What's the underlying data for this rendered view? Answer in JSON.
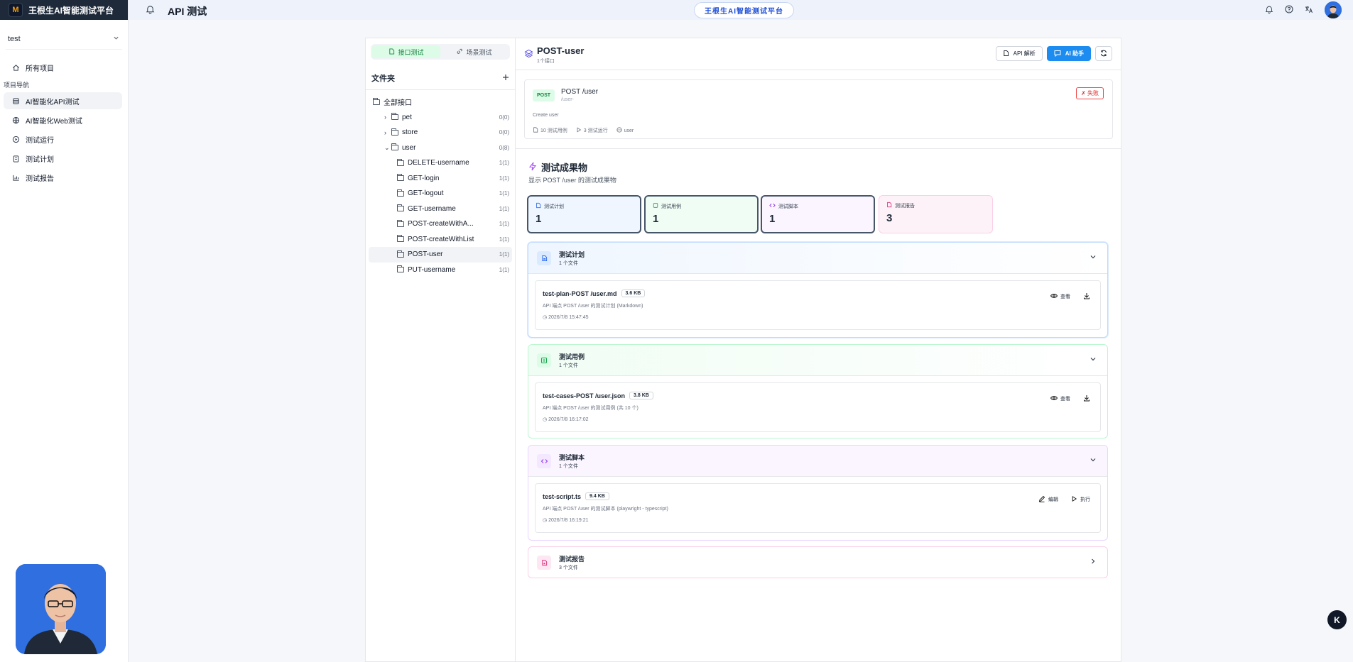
{
  "brand": {
    "logo": "M",
    "name": "王根生AI智能测试平台"
  },
  "sidebar": {
    "project": "test",
    "all_projects": "所有项目",
    "section_label": "项目导航",
    "items": [
      {
        "label": "AI智能化API测试",
        "icon": "database-icon"
      },
      {
        "label": "AI智能化Web测试",
        "icon": "globe-icon"
      },
      {
        "label": "测试运行",
        "icon": "play-icon"
      },
      {
        "label": "测试计划",
        "icon": "clipboard-icon"
      },
      {
        "label": "测试报告",
        "icon": "bar-chart-icon"
      }
    ]
  },
  "topbar": {
    "title": "API 测试",
    "platform": "王根生AI智能测试平台"
  },
  "file_panel": {
    "tabs": [
      "接口测试",
      "场景测试"
    ],
    "header": "文件夹",
    "root": "全部接口",
    "tree": [
      {
        "name": "pet",
        "count": "0(0)"
      },
      {
        "name": "store",
        "count": "0(0)"
      },
      {
        "name": "user",
        "count": "0(8)"
      },
      {
        "name": "DELETE-username",
        "count": "1(1)"
      },
      {
        "name": "GET-login",
        "count": "1(1)"
      },
      {
        "name": "GET-logout",
        "count": "1(1)"
      },
      {
        "name": "GET-username",
        "count": "1(1)"
      },
      {
        "name": "POST-createWithA...",
        "count": "1(1)"
      },
      {
        "name": "POST-createWithList",
        "count": "1(1)"
      },
      {
        "name": "POST-user",
        "count": "1(1)"
      },
      {
        "name": "PUT-username",
        "count": "1(1)"
      }
    ]
  },
  "detail": {
    "title": "POST-user",
    "subtitle": "1个接口",
    "btn_parse": "API 解析",
    "btn_ai": "AI 助手",
    "endpoint": {
      "method": "POST",
      "path": "POST /user",
      "sub": "/user-",
      "status": "✗ 失败",
      "desc": "Create user",
      "cases": "10 测试用例",
      "runs": "3 测试运行",
      "tag": "user"
    },
    "artifacts_title": "测试成果物",
    "artifacts_sub": "显示 POST /user 的测试成果物",
    "stats": [
      {
        "label": "测试计划",
        "value": "1"
      },
      {
        "label": "测试用例",
        "value": "1"
      },
      {
        "label": "测试脚本",
        "value": "1"
      },
      {
        "label": "测试报告",
        "value": "3"
      }
    ],
    "sections": {
      "plan": {
        "title": "测试计划",
        "count": "1 个文件",
        "file": "test-plan-POST /user.md",
        "size": "3.6 KB",
        "desc": "API 端点 POST /user 的测试计划 (Markdown)",
        "time": "2026/7/8 15:47:45",
        "act1": "查看"
      },
      "cases": {
        "title": "测试用例",
        "count": "1 个文件",
        "file": "test-cases-POST /user.json",
        "size": "3.8 KB",
        "desc": "API 端点 POST /user 的测试用例 (共 10 个)",
        "time": "2026/7/8 16:17:02",
        "act1": "查看"
      },
      "script": {
        "title": "测试脚本",
        "count": "1 个文件",
        "file": "test-script.ts",
        "size": "9.4 KB",
        "desc": "API 端点 POST /user 的测试脚本 (playwright - typescript)",
        "time": "2026/7/8 16:19:21",
        "act1": "编辑",
        "act2": "执行"
      },
      "report": {
        "title": "测试报告",
        "count": "3 个文件"
      }
    }
  },
  "floating": {
    "k": "K"
  }
}
